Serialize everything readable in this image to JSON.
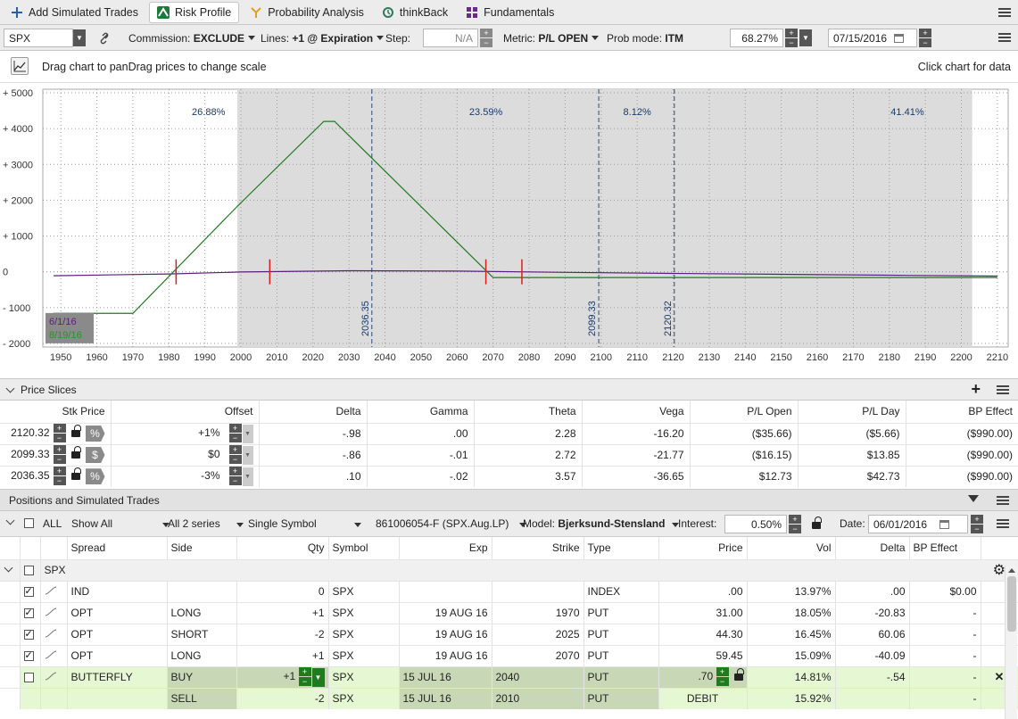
{
  "tabs": [
    {
      "label": "Add Simulated Trades",
      "icon": "plus-icon"
    },
    {
      "label": "Risk Profile",
      "icon": "risk-profile-icon",
      "active": true
    },
    {
      "label": "Probability Analysis",
      "icon": "probability-icon"
    },
    {
      "label": "thinkBack",
      "icon": "thinkback-icon"
    },
    {
      "label": "Fundamentals",
      "icon": "fundamentals-icon"
    }
  ],
  "toolbar": {
    "symbol": "SPX",
    "commission_label": "Commission:",
    "commission_value": "EXCLUDE",
    "lines_label": "Lines:",
    "lines_value": "+1 @ Expiration",
    "step_label": "Step:",
    "step_value": "N/A",
    "metric_label": "Metric:",
    "metric_value": "P/L OPEN",
    "prob_label": "Prob mode:",
    "prob_value": "ITM",
    "percent": "68.27%",
    "date": "07/15/2016"
  },
  "chart_header": {
    "drag_chart": "Drag chart to pan",
    "drag_prices": "Drag prices to change scale",
    "click_hint": "Click chart for data"
  },
  "chart_data": {
    "type": "line",
    "xlim": [
      1945,
      2213
    ],
    "ylim": [
      -2100,
      5100
    ],
    "x_ticks": [
      "1950",
      "1960",
      "1970",
      "1980",
      "1990",
      "2000",
      "2010",
      "2020",
      "2030",
      "2040",
      "2050",
      "2060",
      "2070",
      "2080",
      "2090",
      "2100",
      "2110",
      "2120",
      "2130",
      "2140",
      "2150",
      "2160",
      "2170",
      "2180",
      "2190",
      "2200",
      "2210"
    ],
    "y_ticks": [
      {
        "v": 5000,
        "label": "+ 5000"
      },
      {
        "v": 4000,
        "label": "+ 4000"
      },
      {
        "v": 3000,
        "label": "+ 3000"
      },
      {
        "v": 2000,
        "label": "+ 2000"
      },
      {
        "v": 1000,
        "label": "+ 1000"
      },
      {
        "v": 0,
        "label": "0"
      },
      {
        "v": -1000,
        "label": "- 1000"
      },
      {
        "v": -2000,
        "label": "- 2000"
      }
    ],
    "shaded_range": [
      1999,
      2203
    ],
    "price_lines": [
      {
        "x": 2036.35,
        "label": "2036.35"
      },
      {
        "x": 2099.33,
        "label": "2099.33"
      },
      {
        "x": 2120.32,
        "label": "2120.32"
      }
    ],
    "probabilities": [
      {
        "x": 1991,
        "label": "26.88%"
      },
      {
        "x": 2068,
        "label": "23.59%"
      },
      {
        "x": 2110,
        "label": "8.12%"
      },
      {
        "x": 2185,
        "label": "41.41%"
      }
    ],
    "series": [
      {
        "name": "8/19/16",
        "color": "#1f7a1f",
        "x": [
          1948,
          1970,
          1999,
          2023,
          2026,
          2070,
          2210
        ],
        "y": [
          -1160,
          -1160,
          1830,
          4200,
          4200,
          -160,
          -160
        ]
      },
      {
        "name": "6/1/16",
        "color": "#5a1f7a",
        "x": [
          1948,
          1980,
          2000,
          2030,
          2060,
          2090,
          2120,
          2150,
          2180,
          2210
        ],
        "y": [
          -110,
          -60,
          -5,
          30,
          20,
          -15,
          -45,
          -70,
          -95,
          -120
        ]
      }
    ],
    "breakeven_marks": [
      1982,
      2008,
      2068,
      2078
    ]
  },
  "price_slices": {
    "title": "Price Slices",
    "columns": [
      "Stk Price",
      "Offset",
      "Delta",
      "Gamma",
      "Theta",
      "Vega",
      "P/L Open",
      "P/L Day",
      "BP Effect"
    ],
    "rows": [
      {
        "stk": "2120.32",
        "unit": "%",
        "offset": "+1%",
        "delta": "-.98",
        "gamma": ".00",
        "theta": "2.28",
        "vega": "-16.20",
        "plopen": "($35.66)",
        "plday": "($5.66)",
        "bp": "($990.00)"
      },
      {
        "stk": "2099.33",
        "unit": "$",
        "offset": "$0",
        "delta": "-.86",
        "gamma": "-.01",
        "theta": "2.72",
        "vega": "-21.77",
        "plopen": "($16.15)",
        "plday": "$13.85",
        "bp": "($990.00)"
      },
      {
        "stk": "2036.35",
        "unit": "%",
        "offset": "-3%",
        "delta": ".10",
        "gamma": "-.02",
        "theta": "3.57",
        "vega": "-36.65",
        "plopen": "$12.73",
        "plday": "$42.73",
        "bp": "($990.00)"
      }
    ]
  },
  "positions": {
    "title": "Positions and Simulated Trades",
    "filter_all": "ALL",
    "show_all": "Show All",
    "series": "All 2 series",
    "single_symbol": "Single Symbol",
    "account": "861006054-F (SPX.Aug.LP)",
    "model_label": "Model:",
    "model_value": "Bjerksund-Stensland",
    "interest_label": "Interest:",
    "interest_value": "0.50%",
    "date_label": "Date:",
    "date_value": "06/01/2016",
    "columns": [
      "Spread",
      "Side",
      "Qty",
      "Symbol",
      "Exp",
      "Strike",
      "Type",
      "Price",
      "Vol",
      "Delta",
      "BP Effect"
    ],
    "group": "SPX",
    "rows": [
      {
        "checked": true,
        "spread": "IND",
        "side": "",
        "qty": "0",
        "symbol": "SPX",
        "exp": "",
        "strike": "",
        "type": "INDEX",
        "price": ".00",
        "vol": "13.97%",
        "delta": ".00",
        "bp": "$0.00"
      },
      {
        "checked": true,
        "spread": "OPT",
        "side": "LONG",
        "qty": "+1",
        "symbol": "SPX",
        "exp": "19 AUG 16",
        "strike": "1970",
        "type": "PUT",
        "price": "31.00",
        "vol": "18.05%",
        "delta": "-20.83",
        "bp": "-"
      },
      {
        "checked": true,
        "spread": "OPT",
        "side": "SHORT",
        "qty": "-2",
        "symbol": "SPX",
        "exp": "19 AUG 16",
        "strike": "2025",
        "type": "PUT",
        "price": "44.30",
        "vol": "16.45%",
        "delta": "60.06",
        "bp": "-"
      },
      {
        "checked": true,
        "spread": "OPT",
        "side": "LONG",
        "qty": "+1",
        "symbol": "SPX",
        "exp": "19 AUG 16",
        "strike": "2070",
        "type": "PUT",
        "price": "59.45",
        "vol": "15.09%",
        "delta": "-40.09",
        "bp": "-"
      }
    ],
    "sim_rows": [
      {
        "spread": "BUTTERFLY",
        "side": "BUY",
        "qty": "+1",
        "symbol": "SPX",
        "exp": "15 JUL 16",
        "strike": "2040",
        "type": "PUT",
        "price": ".70",
        "vol": "14.81%",
        "delta": "-.54",
        "bp": "-"
      },
      {
        "spread": "",
        "side": "SELL",
        "qty": "-2",
        "symbol": "SPX",
        "exp": "15 JUL 16",
        "strike": "2010",
        "type": "PUT",
        "price": "DEBIT",
        "vol": "15.92%",
        "delta": "",
        "bp": "-"
      }
    ]
  }
}
